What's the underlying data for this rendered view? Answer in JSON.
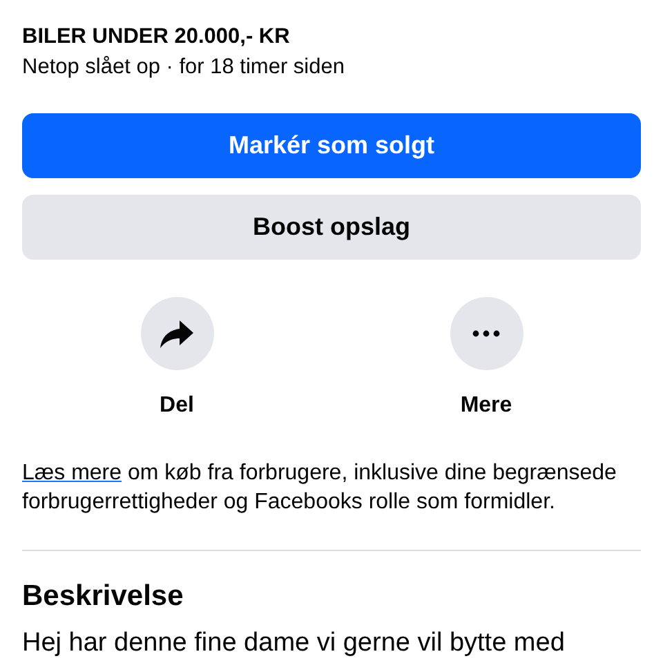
{
  "listing": {
    "title": "BILER UNDER 20.000,- KR",
    "meta": "Netop slået op · for 18 timer siden"
  },
  "buttons": [
    {
      "label": "Markér som solgt",
      "kind": "primary"
    },
    {
      "label": "Boost opslag",
      "kind": "secondary"
    }
  ],
  "actions": [
    {
      "label": "Del",
      "kind": "share"
    },
    {
      "label": "Mere",
      "kind": "more"
    }
  ],
  "info": {
    "link": "Læs mere",
    "text": " om køb fra forbrugere, inklusive dine begrænsede forbrugerrettigheder og Facebooks rolle som formidler."
  },
  "description": {
    "heading": "Beskrivelse",
    "text": "Hej har denne fine dame vi gerne vil bytte med"
  }
}
